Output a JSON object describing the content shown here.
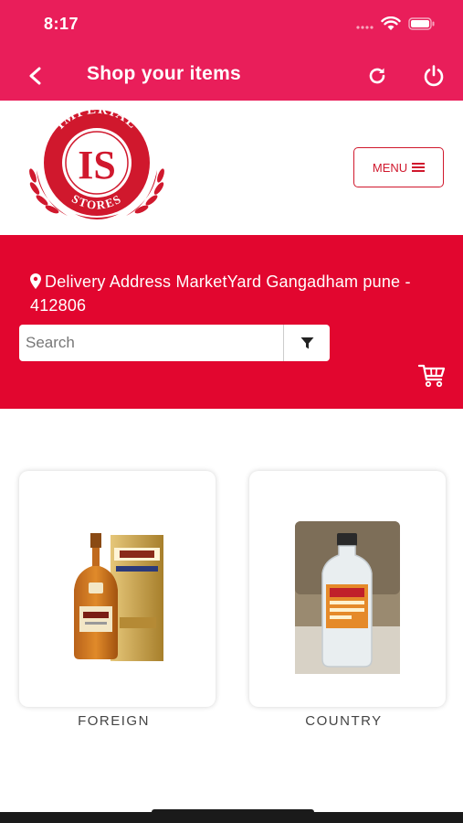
{
  "status_bar": {
    "time": "8:17",
    "icons": [
      "signal-icon",
      "wifi-icon",
      "battery-icon"
    ]
  },
  "app_bar": {
    "title": "Shop your items",
    "background_color": "#e91e5a",
    "icons": [
      "back-arrow-icon",
      "refresh-icon",
      "power-icon"
    ]
  },
  "brand": {
    "logo_text_top": "IMPERIAL",
    "logo_monogram": "IS",
    "logo_text_bottom": "STORES",
    "menu_label": "MENU",
    "accent_color": "#d0182d"
  },
  "delivery": {
    "address_text": "Delivery Address MarketYard Gangadham pune - 412806",
    "band_color": "#e2062f"
  },
  "search": {
    "placeholder": "Search",
    "value": ""
  },
  "categories": [
    {
      "label": "FOREIGN",
      "icon": "whisky-bottle-image"
    },
    {
      "label": "COUNTRY",
      "icon": "clear-bottle-image"
    }
  ]
}
